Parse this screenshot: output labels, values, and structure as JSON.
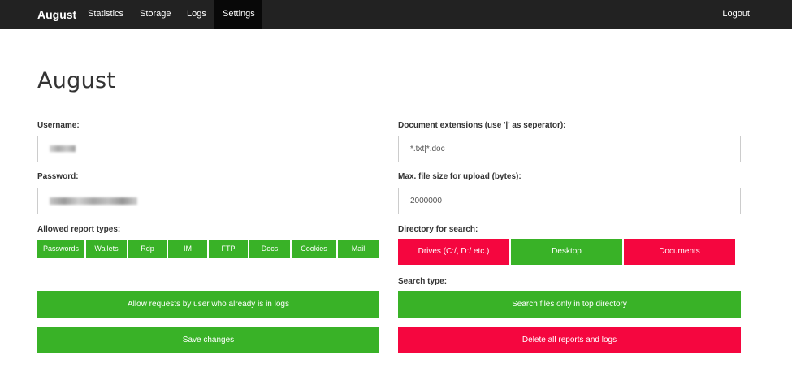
{
  "navbar": {
    "brand": "August",
    "links": [
      "Statistics",
      "Storage",
      "Logs",
      "Settings"
    ],
    "active": "Settings",
    "logout": "Logout"
  },
  "page": {
    "title": "August"
  },
  "left": {
    "username_label": "Username:",
    "password_label": "Password:",
    "report_types_label": "Allowed report types:",
    "report_types": [
      "Passwords",
      "Wallets",
      "Rdp",
      "IM",
      "FTP",
      "Docs",
      "Cookies",
      "Mail"
    ],
    "allow_requests_button": "Allow requests by user who already is in logs",
    "save_button": "Save changes"
  },
  "right": {
    "doc_ext_label": "Document extensions (use '|' as seperator):",
    "doc_ext_value": "*.txt|*.doc",
    "max_size_label": "Max. file size for upload (bytes):",
    "max_size_value": "2000000",
    "directory_label": "Directory for search:",
    "directories": [
      "Drives (C:/, D:/ etc.)",
      "Desktop",
      "Documents"
    ],
    "search_type_label": "Search type:",
    "search_type_button": "Search files only in top directory",
    "delete_button": "Delete all reports and logs"
  },
  "colors": {
    "green": "#39b227",
    "red": "#f5063f",
    "navbar": "#222222"
  }
}
